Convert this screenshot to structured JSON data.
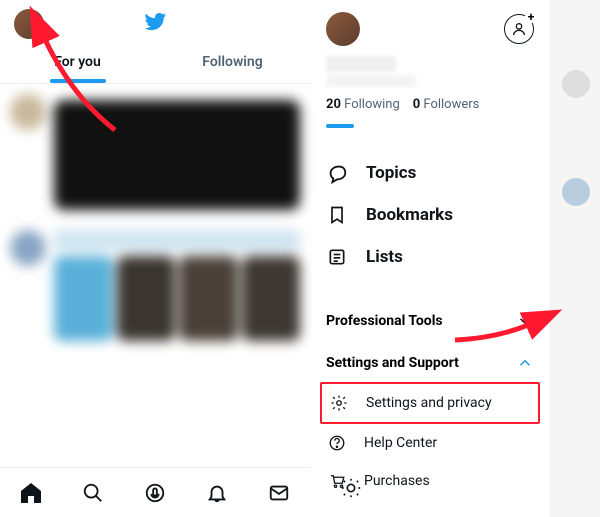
{
  "tabs": {
    "for_you": "For you",
    "following": "Following"
  },
  "stats": {
    "following_count": "20",
    "following_label": "Following",
    "followers_count": "0",
    "followers_label": "Followers"
  },
  "menu": {
    "topics": "Topics",
    "bookmarks": "Bookmarks",
    "lists": "Lists"
  },
  "sections": {
    "professional": "Professional Tools",
    "settings_support": "Settings and Support"
  },
  "submenu": {
    "settings_privacy": "Settings and privacy",
    "help_center": "Help Center",
    "purchases": "Purchases"
  }
}
